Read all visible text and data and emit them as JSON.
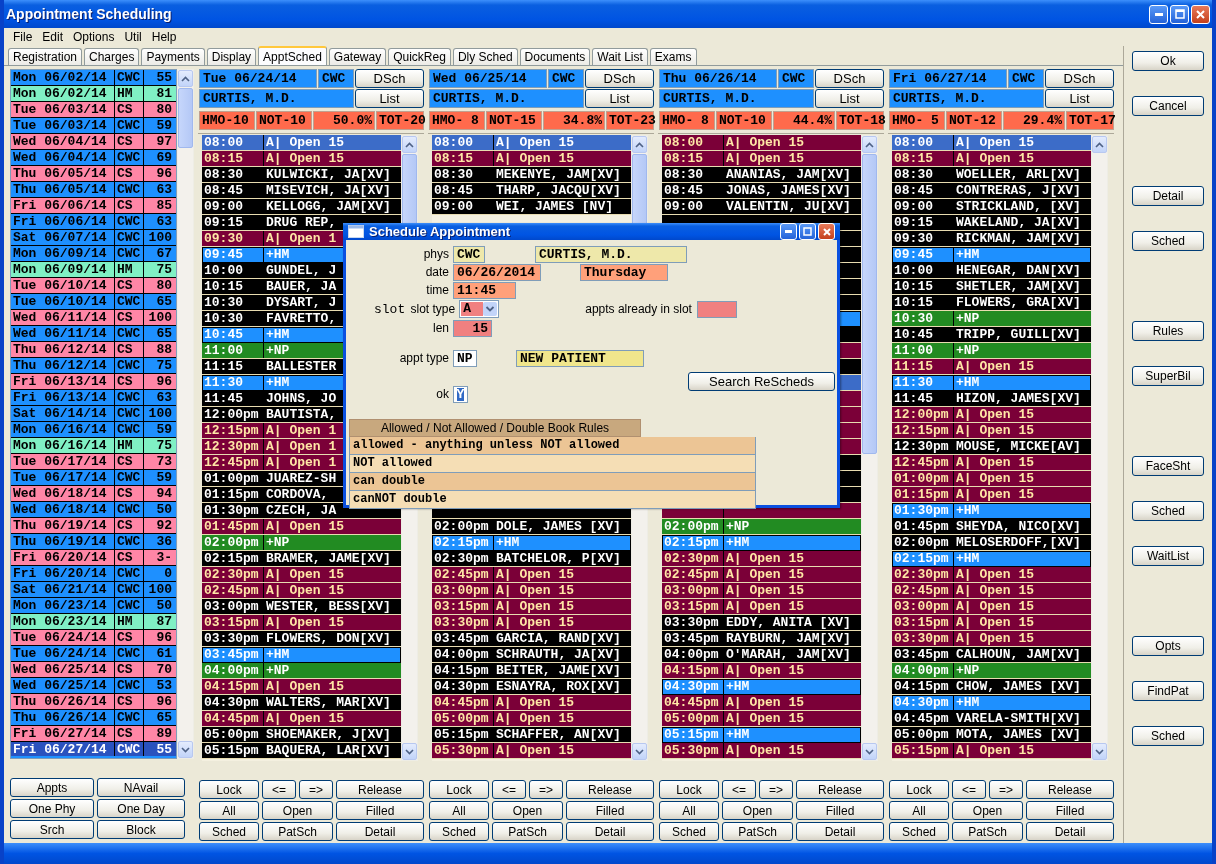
{
  "window": {
    "title": "Appointment Scheduling"
  },
  "menu": [
    "File",
    "Edit",
    "Options",
    "Util",
    "Help"
  ],
  "tabs": [
    {
      "label": "Registration",
      "selected": false
    },
    {
      "label": "Charges",
      "selected": false
    },
    {
      "label": "Payments",
      "selected": false
    },
    {
      "label": "Display",
      "selected": false
    },
    {
      "label": "ApptSched",
      "selected": true
    },
    {
      "label": "Gateway",
      "selected": false
    },
    {
      "label": "QuickReg",
      "selected": false
    },
    {
      "label": "Dly Sched",
      "selected": false
    },
    {
      "label": "Documents",
      "selected": false
    },
    {
      "label": "Wait List",
      "selected": false
    },
    {
      "label": "Exams",
      "selected": false
    }
  ],
  "schedule_list": [
    {
      "date": "Mon 06/02/14",
      "clinic": "CWC",
      "count": "55",
      "color": "#1e90ff",
      "selected": false
    },
    {
      "date": "Mon 06/02/14",
      "clinic": "HM",
      "count": "81",
      "color": "#80f0c4",
      "selected": false
    },
    {
      "date": "Tue 06/03/14",
      "clinic": "CS",
      "count": "80",
      "color": "#ff86a6",
      "selected": false
    },
    {
      "date": "Tue 06/03/14",
      "clinic": "CWC",
      "count": "59",
      "color": "#1e90ff",
      "selected": false
    },
    {
      "date": "Wed 06/04/14",
      "clinic": "CS",
      "count": "97",
      "color": "#ff86a6",
      "selected": false
    },
    {
      "date": "Wed 06/04/14",
      "clinic": "CWC",
      "count": "69",
      "color": "#1e90ff",
      "selected": false
    },
    {
      "date": "Thu 06/05/14",
      "clinic": "CS",
      "count": "96",
      "color": "#ff86a6",
      "selected": false
    },
    {
      "date": "Thu 06/05/14",
      "clinic": "CWC",
      "count": "63",
      "color": "#1e90ff",
      "selected": false
    },
    {
      "date": "Fri 06/06/14",
      "clinic": "CS",
      "count": "85",
      "color": "#ff86a6",
      "selected": false
    },
    {
      "date": "Fri 06/06/14",
      "clinic": "CWC",
      "count": "63",
      "color": "#1e90ff",
      "selected": false
    },
    {
      "date": "Sat 06/07/14",
      "clinic": "CWC",
      "count": "100",
      "color": "#1e90ff",
      "selected": false
    },
    {
      "date": "Mon 06/09/14",
      "clinic": "CWC",
      "count": "67",
      "color": "#1e90ff",
      "selected": false
    },
    {
      "date": "Mon 06/09/14",
      "clinic": "HM",
      "count": "75",
      "color": "#80f0c4",
      "selected": false
    },
    {
      "date": "Tue 06/10/14",
      "clinic": "CS",
      "count": "80",
      "color": "#ff86a6",
      "selected": false
    },
    {
      "date": "Tue 06/10/14",
      "clinic": "CWC",
      "count": "65",
      "color": "#1e90ff",
      "selected": false
    },
    {
      "date": "Wed 06/11/14",
      "clinic": "CS",
      "count": "100",
      "color": "#ff86a6",
      "selected": false
    },
    {
      "date": "Wed 06/11/14",
      "clinic": "CWC",
      "count": "65",
      "color": "#1e90ff",
      "selected": false
    },
    {
      "date": "Thu 06/12/14",
      "clinic": "CS",
      "count": "88",
      "color": "#ff86a6",
      "selected": false
    },
    {
      "date": "Thu 06/12/14",
      "clinic": "CWC",
      "count": "75",
      "color": "#1e90ff",
      "selected": false
    },
    {
      "date": "Fri 06/13/14",
      "clinic": "CS",
      "count": "96",
      "color": "#ff86a6",
      "selected": false
    },
    {
      "date": "Fri 06/13/14",
      "clinic": "CWC",
      "count": "63",
      "color": "#1e90ff",
      "selected": false
    },
    {
      "date": "Sat 06/14/14",
      "clinic": "CWC",
      "count": "100",
      "color": "#1e90ff",
      "selected": false
    },
    {
      "date": "Mon 06/16/14",
      "clinic": "CWC",
      "count": "59",
      "color": "#1e90ff",
      "selected": false
    },
    {
      "date": "Mon 06/16/14",
      "clinic": "HM",
      "count": "75",
      "color": "#80f0c4",
      "selected": false
    },
    {
      "date": "Tue 06/17/14",
      "clinic": "CS",
      "count": "73",
      "color": "#ff86a6",
      "selected": false
    },
    {
      "date": "Tue 06/17/14",
      "clinic": "CWC",
      "count": "59",
      "color": "#1e90ff",
      "selected": false
    },
    {
      "date": "Wed 06/18/14",
      "clinic": "CS",
      "count": "94",
      "color": "#ff86a6",
      "selected": false
    },
    {
      "date": "Wed 06/18/14",
      "clinic": "CWC",
      "count": "50",
      "color": "#1e90ff",
      "selected": false
    },
    {
      "date": "Thu 06/19/14",
      "clinic": "CS",
      "count": "92",
      "color": "#ff86a6",
      "selected": false
    },
    {
      "date": "Thu 06/19/14",
      "clinic": "CWC",
      "count": "36",
      "color": "#1e90ff",
      "selected": false
    },
    {
      "date": "Fri 06/20/14",
      "clinic": "CS",
      "count": "3-",
      "color": "#ff86a6",
      "selected": false
    },
    {
      "date": "Fri 06/20/14",
      "clinic": "CWC",
      "count": "0",
      "color": "#1e90ff",
      "selected": false
    },
    {
      "date": "Sat 06/21/14",
      "clinic": "CWC",
      "count": "100",
      "color": "#1e90ff",
      "selected": false
    },
    {
      "date": "Mon 06/23/14",
      "clinic": "CWC",
      "count": "50",
      "color": "#1e90ff",
      "selected": false
    },
    {
      "date": "Mon 06/23/14",
      "clinic": "HM",
      "count": "87",
      "color": "#80f0c4",
      "selected": false
    },
    {
      "date": "Tue 06/24/14",
      "clinic": "CS",
      "count": "96",
      "color": "#ff86a6",
      "selected": false
    },
    {
      "date": "Tue 06/24/14",
      "clinic": "CWC",
      "count": "61",
      "color": "#1e90ff",
      "selected": false
    },
    {
      "date": "Wed 06/25/14",
      "clinic": "CS",
      "count": "70",
      "color": "#ff86a6",
      "selected": false
    },
    {
      "date": "Wed 06/25/14",
      "clinic": "CWC",
      "count": "53",
      "color": "#1e90ff",
      "selected": false
    },
    {
      "date": "Thu 06/26/14",
      "clinic": "CS",
      "count": "96",
      "color": "#ff86a6",
      "selected": false
    },
    {
      "date": "Thu 06/26/14",
      "clinic": "CWC",
      "count": "65",
      "color": "#1e90ff",
      "selected": false
    },
    {
      "date": "Fri 06/27/14",
      "clinic": "CS",
      "count": "89",
      "color": "#ff86a6",
      "selected": false
    },
    {
      "date": "Fri 06/27/14",
      "clinic": "CWC",
      "count": "55",
      "color": "#1e90ff",
      "selected": true
    }
  ],
  "left_buttons": [
    "Appts",
    "NAvail",
    "One Phy",
    "One Day",
    "Srch",
    "Block"
  ],
  "columns": [
    {
      "date": "Tue 06/24/14",
      "clinic": "CWC",
      "physician": "CURTIS, M.D.",
      "dsch_button": "DSch",
      "list_button": "List",
      "stats": [
        "HMO-10",
        "NOT-10",
        "50.0%",
        "TOT-20"
      ],
      "rows": [
        {
          "time": "08:00",
          "kind": "open",
          "name": "A| Open 15",
          "selected": true
        },
        {
          "time": "08:15",
          "kind": "open",
          "name": "A| Open 15",
          "selected": false
        },
        {
          "time": "08:30",
          "kind": "patient",
          "name": "KULWICKI, JA[XV]",
          "selected": false
        },
        {
          "time": "08:45",
          "kind": "patient",
          "name": "MISEVICH, JA[XV]",
          "selected": false
        },
        {
          "time": "09:00",
          "kind": "patient",
          "name": "KELLOGG, JAM[XV]",
          "selected": false
        },
        {
          "time": "09:15",
          "kind": "patient",
          "name": "DRUG REP,",
          "selected": false
        },
        {
          "time": "09:30",
          "kind": "open",
          "name": "A| Open 1",
          "selected": false
        },
        {
          "time": "09:45",
          "kind": "hm",
          "name": "+HM",
          "selected": false
        },
        {
          "time": "10:00",
          "kind": "patient",
          "name": "GUNDEL, J",
          "selected": false
        },
        {
          "time": "10:15",
          "kind": "patient",
          "name": "BAUER, JA",
          "selected": false
        },
        {
          "time": "10:30",
          "kind": "patient",
          "name": "DYSART, J",
          "selected": false
        },
        {
          "time": "10:30",
          "kind": "patient",
          "name": "FAVRETTO,",
          "selected": false
        },
        {
          "time": "10:45",
          "kind": "hm",
          "name": "+HM",
          "selected": false
        },
        {
          "time": "11:00",
          "kind": "np",
          "name": "+NP",
          "selected": false
        },
        {
          "time": "11:15",
          "kind": "patient",
          "name": "BALLESTER",
          "selected": false
        },
        {
          "time": "11:30",
          "kind": "hm",
          "name": "+HM",
          "selected": false
        },
        {
          "time": "11:45",
          "kind": "patient",
          "name": "JOHNS, JO",
          "selected": false
        },
        {
          "time": "12:00pm",
          "kind": "patient",
          "name": "BAUTISTA,",
          "selected": false
        },
        {
          "time": "12:15pm",
          "kind": "open",
          "name": "A| Open 1",
          "selected": false
        },
        {
          "time": "12:30pm",
          "kind": "open",
          "name": "A| Open 1",
          "selected": false
        },
        {
          "time": "12:45pm",
          "kind": "open",
          "name": "A| Open 1",
          "selected": false
        },
        {
          "time": "01:00pm",
          "kind": "patient",
          "name": "JUAREZ-SH",
          "selected": false
        },
        {
          "time": "01:15pm",
          "kind": "patient",
          "name": "CORDOVA,",
          "selected": false
        },
        {
          "time": "01:30pm",
          "kind": "patient",
          "name": "CZECH, JA",
          "selected": false
        },
        {
          "time": "01:45pm",
          "kind": "open",
          "name": "A| Open 15",
          "selected": false
        },
        {
          "time": "02:00pm",
          "kind": "np",
          "name": "+NP",
          "selected": false
        },
        {
          "time": "02:15pm",
          "kind": "patient",
          "name": "BRAMER, JAME[XV]",
          "selected": false
        },
        {
          "time": "02:30pm",
          "kind": "open",
          "name": "A| Open 15",
          "selected": false
        },
        {
          "time": "02:45pm",
          "kind": "open",
          "name": "A| Open 15",
          "selected": false
        },
        {
          "time": "03:00pm",
          "kind": "patient",
          "name": "WESTER, BESS[XV]",
          "selected": false
        },
        {
          "time": "03:15pm",
          "kind": "open",
          "name": "A| Open 15",
          "selected": false
        },
        {
          "time": "03:30pm",
          "kind": "patient",
          "name": "FLOWERS, DON[XV]",
          "selected": false
        },
        {
          "time": "03:45pm",
          "kind": "hm",
          "name": "+HM",
          "selected": false
        },
        {
          "time": "04:00pm",
          "kind": "np",
          "name": "+NP",
          "selected": false
        },
        {
          "time": "04:15pm",
          "kind": "open",
          "name": "A| Open 15",
          "selected": false
        },
        {
          "time": "04:30pm",
          "kind": "patient",
          "name": "WALTERS, MAR[XV]",
          "selected": false
        },
        {
          "time": "04:45pm",
          "kind": "open",
          "name": "A| Open 15",
          "selected": false
        },
        {
          "time": "05:00pm",
          "kind": "patient",
          "name": "SHOEMAKER, J[XV]",
          "selected": false
        },
        {
          "time": "05:15pm",
          "kind": "patient",
          "name": "BAQUERA, LAR[XV]",
          "selected": false
        }
      ],
      "buttons": [
        "Lock",
        "<=",
        "=>",
        "Release",
        "All",
        "Open",
        "Filled",
        "Sched",
        "PatSch",
        "Detail"
      ]
    },
    {
      "date": "Wed 06/25/14",
      "clinic": "CWC",
      "physician": "CURTIS, M.D.",
      "dsch_button": "DSch",
      "list_button": "List",
      "stats": [
        "HMO- 8",
        "NOT-15",
        "34.8%",
        "TOT-23"
      ],
      "rows": [
        {
          "time": "08:00",
          "kind": "open",
          "name": "A| Open 15",
          "selected": true
        },
        {
          "time": "08:15",
          "kind": "open",
          "name": "A| Open 15",
          "selected": false
        },
        {
          "time": "08:30",
          "kind": "patient",
          "name": "MEKENYE, JAM[XV]",
          "selected": false
        },
        {
          "time": "08:45",
          "kind": "patient",
          "name": "THARP, JACQU[XV]",
          "selected": false
        },
        {
          "time": "09:00",
          "kind": "patient",
          "name": "WEI, JAMES [NV]",
          "selected": false
        },
        {},
        {},
        {},
        {},
        {},
        {},
        {},
        {},
        {},
        {},
        {},
        {},
        {},
        {},
        {},
        {},
        {},
        {},
        {
          "kind": "patient",
          "selected": false
        },
        {
          "time": "02:00pm",
          "kind": "patient",
          "name": "DOLE, JAMES [XV]",
          "selected": false
        },
        {
          "time": "02:15pm",
          "kind": "hm",
          "name": "+HM",
          "selected": false
        },
        {
          "time": "02:30pm",
          "kind": "patient",
          "name": "BATCHELOR, P[XV]",
          "selected": false
        },
        {
          "time": "02:45pm",
          "kind": "open",
          "name": "A| Open 15",
          "selected": false
        },
        {
          "time": "03:00pm",
          "kind": "open",
          "name": "A| Open 15",
          "selected": false
        },
        {
          "time": "03:15pm",
          "kind": "open",
          "name": "A| Open 15",
          "selected": false
        },
        {
          "time": "03:30pm",
          "kind": "open",
          "name": "A| Open 15",
          "selected": false
        },
        {
          "time": "03:45pm",
          "kind": "patient",
          "name": "GARCIA, RAND[XV]",
          "selected": false
        },
        {
          "time": "04:00pm",
          "kind": "patient",
          "name": "SCHRAUTH, JA[XV]",
          "selected": false
        },
        {
          "time": "04:15pm",
          "kind": "patient",
          "name": "BEITER, JAME[XV]",
          "selected": false
        },
        {
          "time": "04:30pm",
          "kind": "patient",
          "name": "ESNAYRA, ROX[XV]",
          "selected": false
        },
        {
          "time": "04:45pm",
          "kind": "open",
          "name": "A| Open 15",
          "selected": false
        },
        {
          "time": "05:00pm",
          "kind": "open",
          "name": "A| Open 15",
          "selected": false
        },
        {
          "time": "05:15pm",
          "kind": "patient",
          "name": "SCHAFFER, AN[XV]",
          "selected": false
        },
        {
          "time": "05:30pm",
          "kind": "open",
          "name": "A| Open 15",
          "selected": false
        }
      ],
      "buttons": [
        "Lock",
        "<=",
        "=>",
        "Release",
        "All",
        "Open",
        "Filled",
        "Sched",
        "PatSch",
        "Detail"
      ]
    },
    {
      "date": "Thu 06/26/14",
      "clinic": "CWC",
      "physician": "CURTIS, M.D.",
      "dsch_button": "DSch",
      "list_button": "List",
      "stats": [
        "HMO- 8",
        "NOT-10",
        "44.4%",
        "TOT-18"
      ],
      "rows": [
        {
          "time": "08:00",
          "kind": "open",
          "name": "A| Open 15",
          "selected": false
        },
        {
          "time": "08:15",
          "kind": "open",
          "name": "A| Open 15",
          "selected": false
        },
        {
          "time": "08:30",
          "kind": "patient",
          "name": "ANANIAS, JAM[XV]",
          "selected": false
        },
        {
          "time": "08:45",
          "kind": "patient",
          "name": "JONAS, JAMES[XV]",
          "selected": false
        },
        {
          "time": "09:00",
          "kind": "patient",
          "name": "VALENTIN, JU[XV]",
          "selected": false
        },
        {
          "kind": "patient",
          "selected": false
        },
        {
          "kind": "patient",
          "selected": false
        },
        {
          "kind": "patient",
          "selected": false
        },
        {
          "kind": "patient",
          "selected": false
        },
        {
          "kind": "patient",
          "selected": false
        },
        {
          "kind": "patient",
          "selected": false
        },
        {
          "kind": "hm",
          "selected": false
        },
        {
          "kind": "patient",
          "selected": false
        },
        {
          "kind": "open",
          "selected": false
        },
        {
          "kind": "patient",
          "selected": false
        },
        {
          "kind": "open",
          "selected": true
        },
        {
          "kind": "open",
          "selected": false
        },
        {
          "kind": "open",
          "selected": false
        },
        {
          "kind": "open",
          "selected": false
        },
        {
          "kind": "open",
          "selected": false
        },
        {
          "kind": "patient",
          "selected": false
        },
        {
          "kind": "patient",
          "selected": false
        },
        {
          "kind": "patient",
          "selected": false
        },
        {
          "kind": "open",
          "selected": false
        },
        {
          "time": "02:00pm",
          "kind": "np",
          "name": "+NP",
          "selected": false
        },
        {
          "time": "02:15pm",
          "kind": "hm",
          "name": "+HM",
          "selected": false
        },
        {
          "time": "02:30pm",
          "kind": "open",
          "name": "A| Open 15",
          "selected": false
        },
        {
          "time": "02:45pm",
          "kind": "open",
          "name": "A| Open 15",
          "selected": false
        },
        {
          "time": "03:00pm",
          "kind": "open",
          "name": "A| Open 15",
          "selected": false
        },
        {
          "time": "03:15pm",
          "kind": "open",
          "name": "A| Open 15",
          "selected": false
        },
        {
          "time": "03:30pm",
          "kind": "patient",
          "name": "EDDY, ANITA [XV]",
          "selected": false
        },
        {
          "time": "03:45pm",
          "kind": "patient",
          "name": "RAYBURN, JAM[XV]",
          "selected": false
        },
        {
          "time": "04:00pm",
          "kind": "patient",
          "name": "O'MARAH, JAM[XV]",
          "selected": false
        },
        {
          "time": "04:15pm",
          "kind": "open",
          "name": "A| Open 15",
          "selected": false
        },
        {
          "time": "04:30pm",
          "kind": "hm",
          "name": "+HM",
          "selected": false
        },
        {
          "time": "04:45pm",
          "kind": "open",
          "name": "A| Open 15",
          "selected": false
        },
        {
          "time": "05:00pm",
          "kind": "open",
          "name": "A| Open 15",
          "selected": false
        },
        {
          "time": "05:15pm",
          "kind": "hm",
          "name": "+HM",
          "selected": false
        },
        {
          "time": "05:30pm",
          "kind": "open",
          "name": "A| Open 15",
          "selected": false
        }
      ],
      "buttons": [
        "Lock",
        "<=",
        "=>",
        "Release",
        "All",
        "Open",
        "Filled",
        "Sched",
        "PatSch",
        "Detail"
      ]
    },
    {
      "date": "Fri 06/27/14",
      "clinic": "CWC",
      "physician": "CURTIS, M.D.",
      "dsch_button": "DSch",
      "list_button": "List",
      "stats": [
        "HMO- 5",
        "NOT-12",
        "29.4%",
        "TOT-17"
      ],
      "rows": [
        {
          "time": "08:00",
          "kind": "open",
          "name": "A| Open 15",
          "selected": true
        },
        {
          "time": "08:15",
          "kind": "open",
          "name": "A| Open 15",
          "selected": false
        },
        {
          "time": "08:30",
          "kind": "patient",
          "name": "WOELLER, ARL[XV]",
          "selected": false
        },
        {
          "time": "08:45",
          "kind": "patient",
          "name": "CONTRERAS, J[XV]",
          "selected": false
        },
        {
          "time": "09:00",
          "kind": "patient",
          "name": "STRICKLAND, [XV]",
          "selected": false
        },
        {
          "time": "09:15",
          "kind": "patient",
          "name": "WAKELAND, JA[XV]",
          "selected": false
        },
        {
          "time": "09:30",
          "kind": "patient",
          "name": "RICKMAN, JAM[XV]",
          "selected": false
        },
        {
          "time": "09:45",
          "kind": "hm",
          "name": "+HM",
          "selected": false
        },
        {
          "time": "10:00",
          "kind": "patient",
          "name": "HENEGAR, DAN[XV]",
          "selected": false
        },
        {
          "time": "10:15",
          "kind": "patient",
          "name": "SHETLER, JAM[XV]",
          "selected": false
        },
        {
          "time": "10:15",
          "kind": "patient",
          "name": "FLOWERS, GRA[XV]",
          "selected": false
        },
        {
          "time": "10:30",
          "kind": "np",
          "name": "+NP",
          "selected": false
        },
        {
          "time": "10:45",
          "kind": "patient",
          "name": "TRIPP, GUILL[XV]",
          "selected": false
        },
        {
          "time": "11:00",
          "kind": "np",
          "name": "+NP",
          "selected": false
        },
        {
          "time": "11:15",
          "kind": "open",
          "name": "A| Open 15",
          "selected": false
        },
        {
          "time": "11:30",
          "kind": "hm",
          "name": "+HM",
          "selected": false
        },
        {
          "time": "11:45",
          "kind": "patient",
          "name": "HIZON, JAMES[XV]",
          "selected": false
        },
        {
          "time": "12:00pm",
          "kind": "open",
          "name": "A| Open 15",
          "selected": false
        },
        {
          "time": "12:15pm",
          "kind": "open",
          "name": "A| Open 15",
          "selected": false
        },
        {
          "time": "12:30pm",
          "kind": "patient",
          "name": "MOUSE, MICKE[AV]",
          "selected": false
        },
        {
          "time": "12:45pm",
          "kind": "open",
          "name": "A| Open 15",
          "selected": false
        },
        {
          "time": "01:00pm",
          "kind": "open",
          "name": "A| Open 15",
          "selected": false
        },
        {
          "time": "01:15pm",
          "kind": "open",
          "name": "A| Open 15",
          "selected": false
        },
        {
          "time": "01:30pm",
          "kind": "hm",
          "name": "+HM",
          "selected": false
        },
        {
          "time": "01:45pm",
          "kind": "patient",
          "name": "SHEYDA, NICO[XV]",
          "selected": false
        },
        {
          "time": "02:00pm",
          "kind": "patient",
          "name": "MELOSERDOFF,[XV]",
          "selected": false
        },
        {
          "time": "02:15pm",
          "kind": "hm",
          "name": "+HM",
          "selected": false
        },
        {
          "time": "02:30pm",
          "kind": "open",
          "name": "A| Open 15",
          "selected": false
        },
        {
          "time": "02:45pm",
          "kind": "open",
          "name": "A| Open 15",
          "selected": false
        },
        {
          "time": "03:00pm",
          "kind": "open",
          "name": "A| Open 15",
          "selected": false
        },
        {
          "time": "03:15pm",
          "kind": "open",
          "name": "A| Open 15",
          "selected": false
        },
        {
          "time": "03:30pm",
          "kind": "open",
          "name": "A| Open 15",
          "selected": false
        },
        {
          "time": "03:45pm",
          "kind": "patient",
          "name": "CALHOUN, JAM[XV]",
          "selected": false
        },
        {
          "time": "04:00pm",
          "kind": "np",
          "name": "+NP",
          "selected": false
        },
        {
          "time": "04:15pm",
          "kind": "patient",
          "name": "CHOW, JAMES [XV]",
          "selected": false
        },
        {
          "time": "04:30pm",
          "kind": "hm",
          "name": "+HM",
          "selected": false
        },
        {
          "time": "04:45pm",
          "kind": "patient",
          "name": "VARELA-SMITH[XV]",
          "selected": false
        },
        {
          "time": "05:00pm",
          "kind": "patient",
          "name": "MOTA, JAMES [XV]",
          "selected": false
        },
        {
          "time": "05:15pm",
          "kind": "open",
          "name": "A| Open 15",
          "selected": false
        }
      ],
      "buttons": [
        "Lock",
        "<=",
        "=>",
        "Release",
        "All",
        "Open",
        "Filled",
        "Sched",
        "PatSch",
        "Detail"
      ]
    }
  ],
  "right_buttons": [
    [
      "Ok",
      "Cancel"
    ],
    [
      "Detail",
      "Sched"
    ],
    [
      "Rules",
      "SuperBil"
    ],
    [
      "FaceSht",
      "Sched",
      "WaitList"
    ],
    [
      "Opts",
      "FindPat",
      "Sched"
    ]
  ],
  "dialog": {
    "title": "Schedule Appointment",
    "phys_label": "phys",
    "phys_code": "CWC",
    "phys_name": "CURTIS, M.D.",
    "date_label": "date",
    "date": "06/26/2014",
    "weekday": "Thursday",
    "time_label": "time",
    "time": "11:45",
    "slot_label": "slot",
    "slot_type_label": "slot type",
    "slot_type": "A",
    "appts_label": "appts already in slot",
    "len_label": "len",
    "len": "15",
    "appt_type_label": "appt type",
    "appt_type": "NP",
    "appt_type_name": "NEW PATIENT",
    "search_button": "Search ReScheds",
    "ok_label": "ok",
    "ok": "Y",
    "rules_title": "Allowed / Not Allowed / Double Book Rules",
    "rules": [
      "allowed - anything unless NOT allowed",
      "NOT allowed",
      "can double",
      "canNOT double"
    ]
  }
}
